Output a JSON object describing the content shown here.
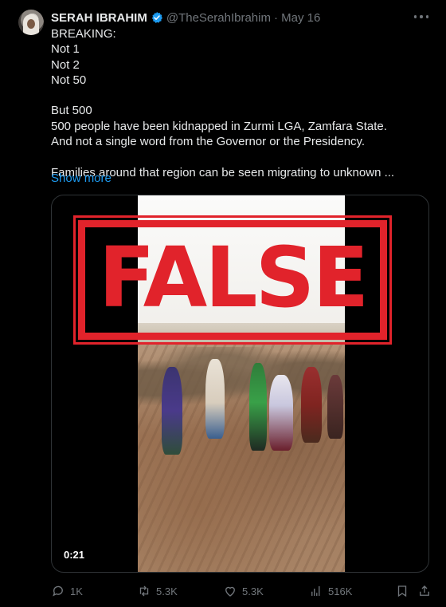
{
  "author": {
    "name": "SERAH IBRAHIM",
    "handle": "@TheSerahIbrahim",
    "date": "· May 16"
  },
  "tweet_lines": [
    "BREAKING:",
    "Not 1",
    "Not 2",
    "Not 50",
    "",
    "But 500",
    "500 people have been kidnapped in Zurmi LGA, Zamfara State.",
    "And not a single word from the Governor or the Presidency.",
    "",
    "Families around that region can be seen migrating to unknown ..."
  ],
  "show_more": "Show more",
  "media": {
    "stamp_text": "FALSE",
    "duration": "0:21"
  },
  "actions": {
    "replies": "1K",
    "reposts": "5.3K",
    "likes": "5.3K",
    "views": "516K"
  },
  "colors": {
    "accent": "#1d9bf0",
    "stamp": "#e1232b",
    "muted": "#71767b"
  }
}
